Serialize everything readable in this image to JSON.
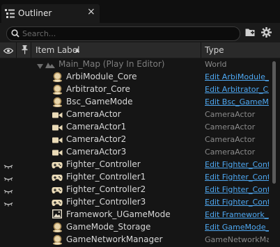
{
  "tab": {
    "title": "Outliner",
    "close": "×"
  },
  "search": {
    "placeholder": "Search..."
  },
  "header": {
    "item_label": "Item Label",
    "sort": "▲",
    "type": "Type"
  },
  "rows": [
    {
      "label": "Main_Map (Play In Editor)",
      "type": "World",
      "kind": "map",
      "link": false,
      "eye": false
    },
    {
      "label": "ArbiModule_Core",
      "type": "Edit ArbiModule_Core",
      "kind": "actor",
      "link": true,
      "eye": false
    },
    {
      "label": "Arbitrator_Core",
      "type": "Edit Arbitrator_Core",
      "kind": "actor",
      "link": true,
      "eye": false
    },
    {
      "label": "Bsc_GameMode",
      "type": "Edit Bsc_GameMode",
      "kind": "actor",
      "link": true,
      "eye": false
    },
    {
      "label": "CameraActor",
      "type": "CameraActor",
      "kind": "camera",
      "link": false,
      "eye": false
    },
    {
      "label": "CameraActor1",
      "type": "CameraActor",
      "kind": "camera",
      "link": false,
      "eye": false
    },
    {
      "label": "CameraActor2",
      "type": "CameraActor",
      "kind": "camera",
      "link": false,
      "eye": false
    },
    {
      "label": "CameraActor3",
      "type": "CameraActor",
      "kind": "camera",
      "link": false,
      "eye": false
    },
    {
      "label": "Fighter_Controller",
      "type": "Edit Fighter_Controller",
      "kind": "gamepad",
      "link": true,
      "eye": true
    },
    {
      "label": "Fighter_Controller1",
      "type": "Edit Fighter_Controller",
      "kind": "gamepad",
      "link": true,
      "eye": true
    },
    {
      "label": "Fighter_Controller2",
      "type": "Edit Fighter_Controller",
      "kind": "gamepad",
      "link": true,
      "eye": true
    },
    {
      "label": "Fighter_Controller3",
      "type": "Edit Fighter_Controller",
      "kind": "gamepad",
      "link": true,
      "eye": true
    },
    {
      "label": "Framework_UGameMode",
      "type": "Edit Framework_UGameMode",
      "kind": "image",
      "link": true,
      "eye": false
    },
    {
      "label": "GameMode_Storage",
      "type": "Edit GameMode_Storage",
      "kind": "actor",
      "link": true,
      "eye": false
    },
    {
      "label": "GameNetworkManager",
      "type": "GameNetworkManager",
      "kind": "actor",
      "link": false,
      "eye": false
    }
  ],
  "colors": {
    "link": "#4ea8f2",
    "text": "#d8d8d8",
    "dim": "#8a8a8a",
    "background": "#151515",
    "icon": "#e0c9a0"
  },
  "icons": {
    "tab": "outliner-icon",
    "search": "search-icon",
    "add_folder": "add-folder-icon",
    "settings": "gear-icon",
    "visibility": "eye-icon",
    "pin": "pin-icon",
    "expand": "triangle-down-icon"
  }
}
